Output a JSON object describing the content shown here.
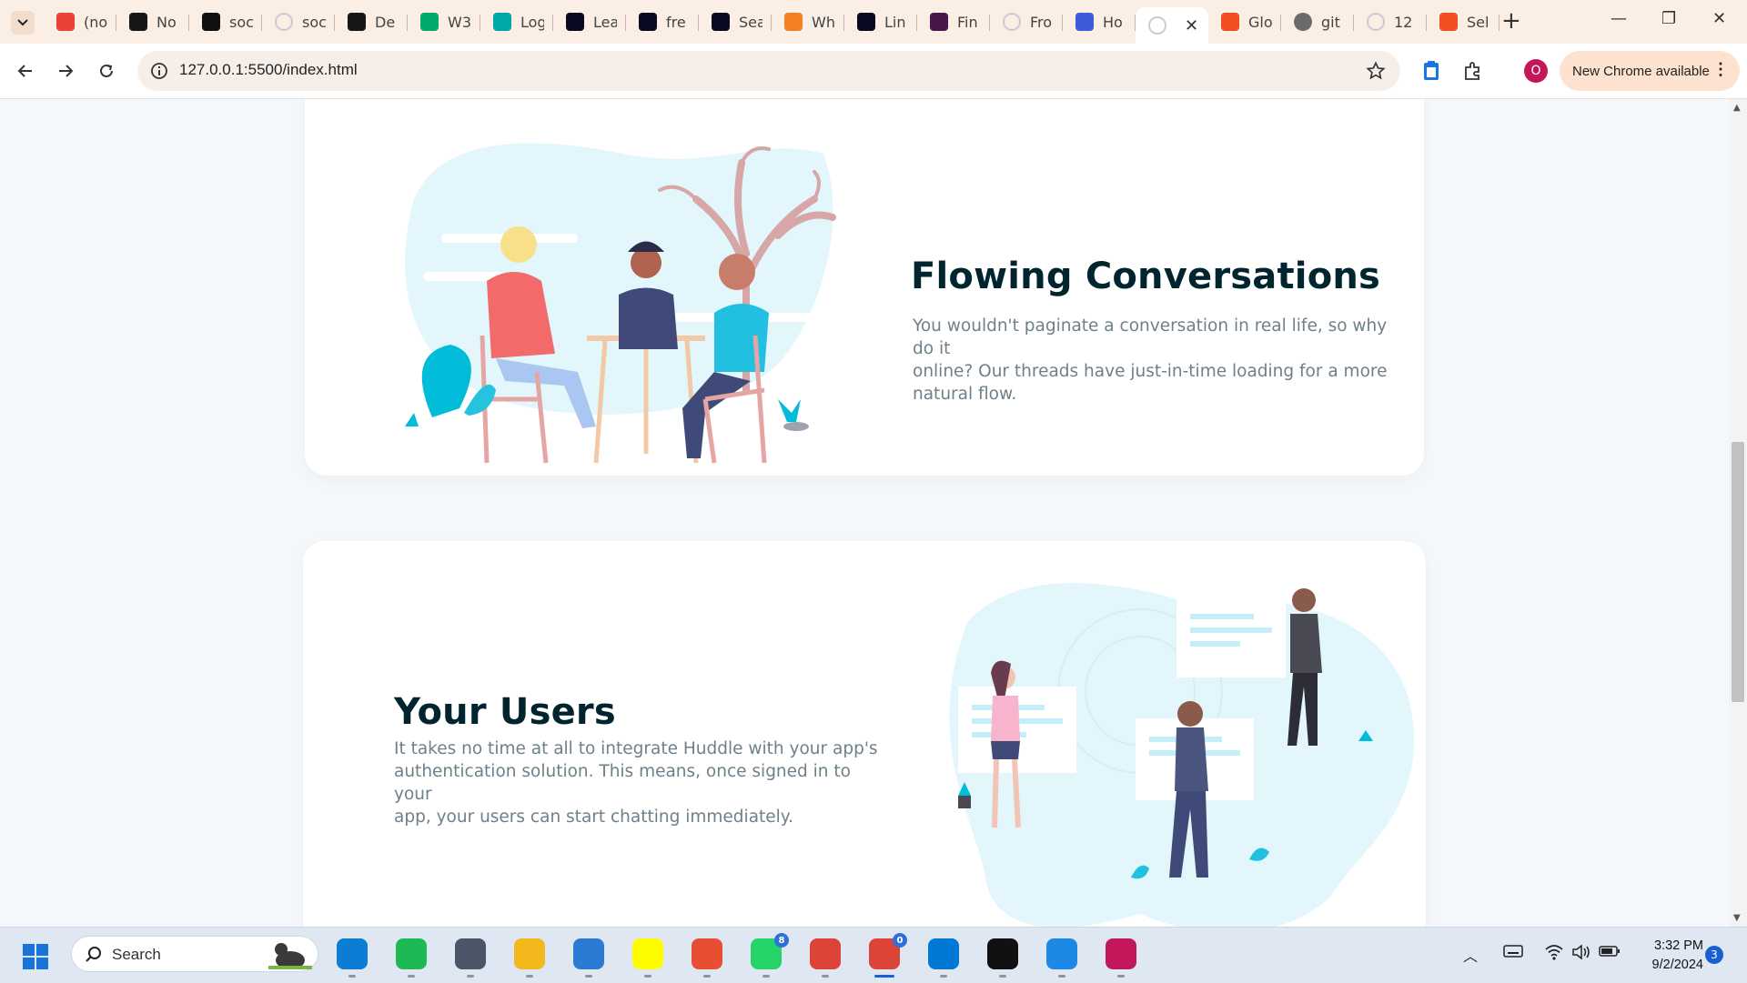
{
  "browser": {
    "tabs": [
      {
        "title": "(no",
        "favicon": "gmail-icon",
        "color": "#ea4335"
      },
      {
        "title": "No",
        "favicon": "github-icon",
        "color": "#181717"
      },
      {
        "title": "soc",
        "favicon": "appwrite-icon",
        "color": "#111111"
      },
      {
        "title": "soc",
        "favicon": "loading-icon",
        "color": "#9aa0a6"
      },
      {
        "title": "De",
        "favicon": "github-icon",
        "color": "#181717"
      },
      {
        "title": "W3",
        "favicon": "w3schools-icon",
        "color": "#04aa6d"
      },
      {
        "title": "Log",
        "favicon": "diamond-icon",
        "color": "#00a8a8"
      },
      {
        "title": "Lea",
        "favicon": "freecodecamp-icon",
        "color": "#0a0a23"
      },
      {
        "title": "fre",
        "favicon": "freecodecamp-icon",
        "color": "#0a0a23"
      },
      {
        "title": "Sea",
        "favicon": "freecodecamp-icon",
        "color": "#0a0a23"
      },
      {
        "title": "Wh",
        "favicon": "stackoverflow-icon",
        "color": "#f48024"
      },
      {
        "title": "Lin",
        "favicon": "freecodecamp-icon",
        "color": "#0a0a23"
      },
      {
        "title": "Fin",
        "favicon": "slack-icon",
        "color": "#4a154b"
      },
      {
        "title": "Fro",
        "favicon": "loading-icon",
        "color": "#9aa0a6"
      },
      {
        "title": "Ho",
        "favicon": "flag-icon",
        "color": "#3b5bdb"
      },
      {
        "title": "",
        "favicon": "loading-icon",
        "color": "#9aa0a6",
        "active": true
      },
      {
        "title": "Glo",
        "favicon": "figma-icon",
        "color": "#f24e1e"
      },
      {
        "title": "git",
        "favicon": "globe-icon",
        "color": "#6b6b6b"
      },
      {
        "title": "12",
        "favicon": "loading-icon",
        "color": "#9aa0a6"
      },
      {
        "title": "Sel",
        "favicon": "microsoft-icon",
        "color": "#f25022"
      }
    ],
    "url": "127.0.0.1:5500/index.html",
    "profile_initial": "O",
    "update_label": "New Chrome available"
  },
  "page": {
    "feature1": {
      "heading": "Flowing Conversations",
      "body_lines": [
        "You wouldn't paginate a conversation in real life, so why do it",
        "online? Our threads have just-in-time loading for a more",
        "natural flow."
      ]
    },
    "feature2": {
      "heading": "Your Users",
      "body_lines": [
        "It takes no time at all to integrate Huddle with your app's",
        "authentication solution. This means, once signed in to your",
        "app, your users can start chatting immediately."
      ]
    },
    "colors": {
      "heading": "#00252e",
      "body": "#6e8089",
      "accent_cyan": "#00bcd8",
      "blob": "#e3f6fc"
    }
  },
  "taskbar": {
    "search_label": "Search",
    "apps": [
      {
        "name": "edge-icon",
        "color": "#0c7cd5"
      },
      {
        "name": "spotify-icon",
        "color": "#1db954"
      },
      {
        "name": "phone-link-icon",
        "color": "#4a5568"
      },
      {
        "name": "file-explorer-icon",
        "color": "#f3b81b"
      },
      {
        "name": "notepad-icon",
        "color": "#2b7bd4"
      },
      {
        "name": "snapchat-icon",
        "color": "#fffc00"
      },
      {
        "name": "git-icon",
        "color": "#e84e31"
      },
      {
        "name": "whatsapp-icon",
        "color": "#25d366",
        "badge": "8"
      },
      {
        "name": "chrome-profile-icon",
        "color": "#db4437"
      },
      {
        "name": "chrome-icon",
        "color": "#db4437",
        "badge": "0",
        "active": true
      },
      {
        "name": "vscode-icon",
        "color": "#0078d4"
      },
      {
        "name": "intellij-icon",
        "color": "#111111"
      },
      {
        "name": "paint-icon",
        "color": "#1e88e5"
      },
      {
        "name": "snipping-tool-icon",
        "color": "#c2185b"
      }
    ],
    "time": "3:32 PM",
    "date": "9/2/2024",
    "notification_count": "3"
  }
}
